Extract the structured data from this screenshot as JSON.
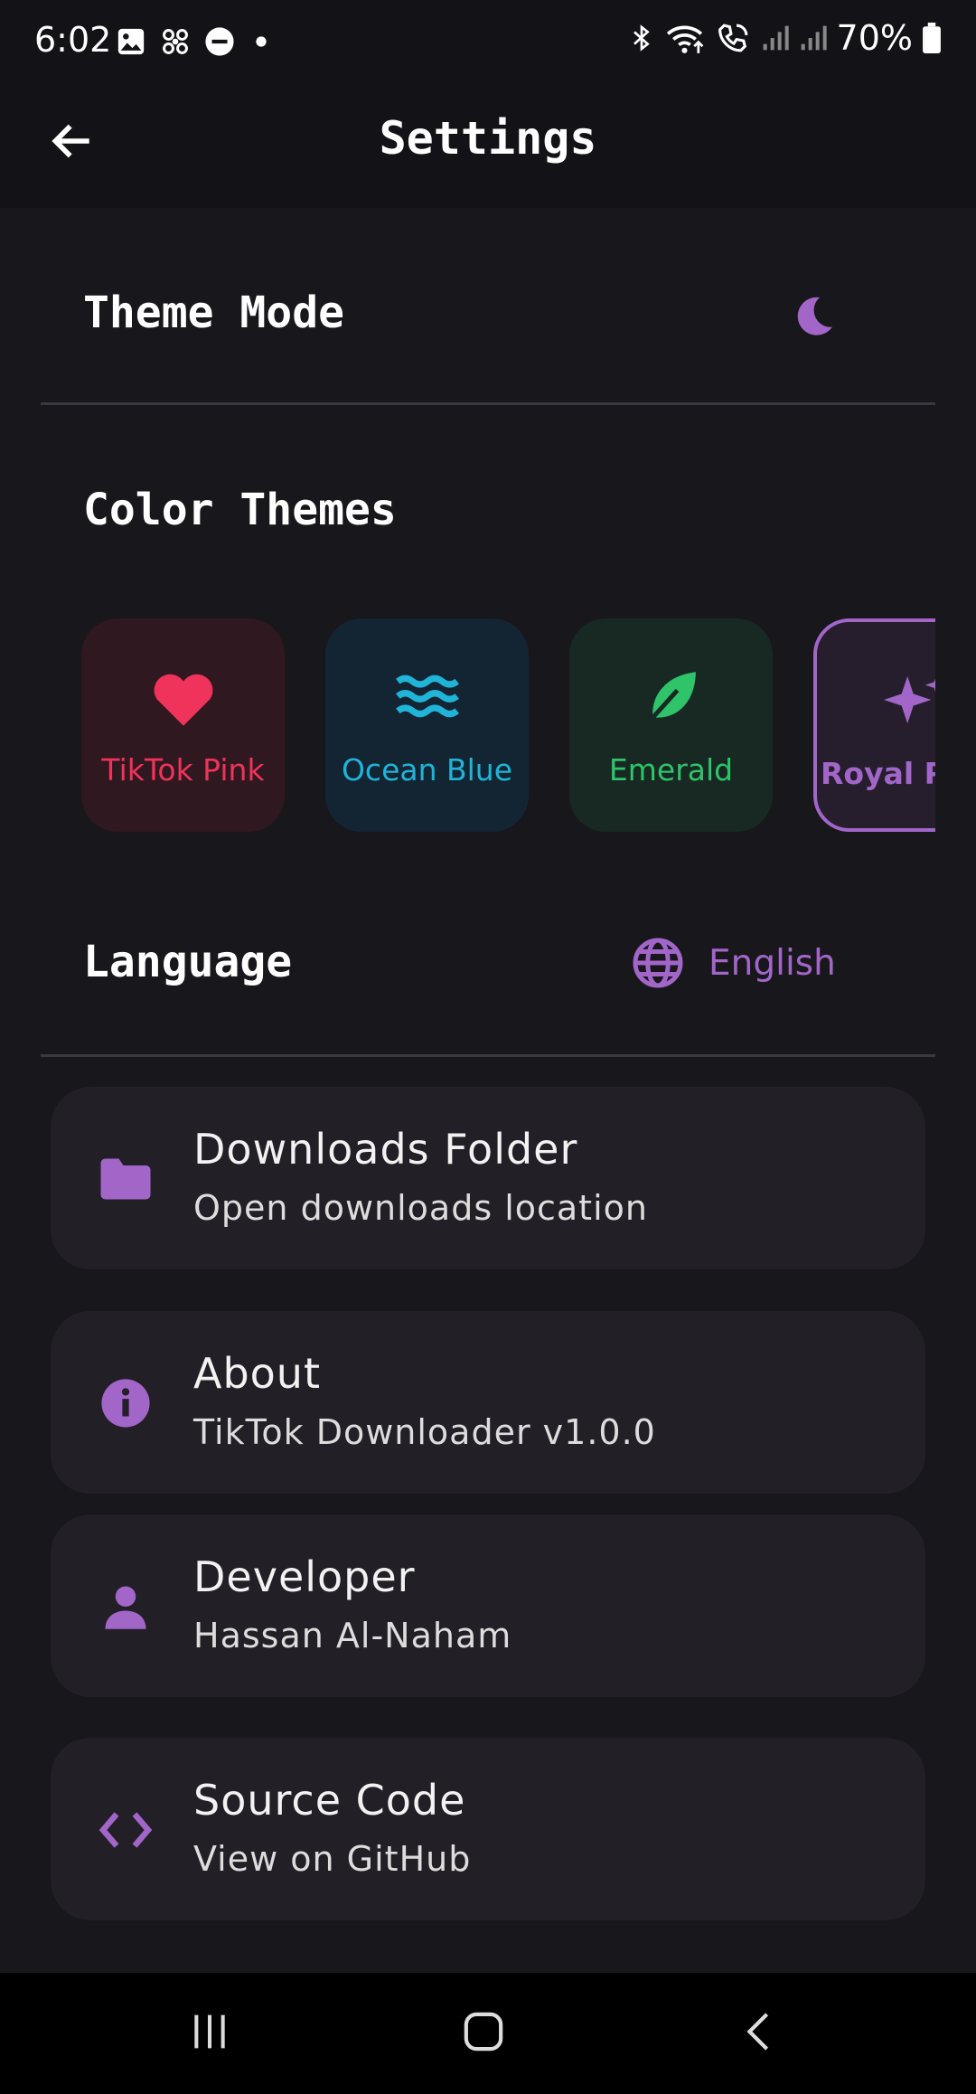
{
  "status_bar": {
    "time": "6:02",
    "battery": "70%",
    "icons": [
      "gallery-icon",
      "fan-icon",
      "dnd-icon",
      "dot-icon",
      "bluetooth-icon",
      "wifi-icon",
      "wifi-call-icon",
      "signal-icon",
      "signal-icon",
      "battery-icon"
    ]
  },
  "header": {
    "title": "Settings",
    "back_icon": "arrow-left-icon"
  },
  "theme_mode": {
    "label": "Theme Mode",
    "icon": "moon-icon"
  },
  "color_themes": {
    "label": "Color Themes",
    "items": [
      {
        "label": "TikTok Pink",
        "icon": "heart-icon",
        "color": "#f0335a",
        "bg": "#2f1820",
        "selected": false
      },
      {
        "label": "Ocean Blue",
        "icon": "waves-icon",
        "color": "#1fb4d8",
        "bg": "#132433",
        "selected": false
      },
      {
        "label": "Emerald",
        "icon": "leaf-icon",
        "color": "#2fc36a",
        "bg": "#172922",
        "selected": false
      },
      {
        "label": "Royal Pu",
        "icon": "sparkle-icon",
        "color": "#a266c9",
        "bg": "#261e2d",
        "selected": true
      }
    ]
  },
  "language": {
    "label": "Language",
    "value": "English",
    "icon": "globe-icon"
  },
  "list": [
    {
      "title": "Downloads Folder",
      "subtitle": "Open downloads location",
      "icon": "folder-icon"
    },
    {
      "title": "About",
      "subtitle": "TikTok Downloader v1.0.0",
      "icon": "info-icon"
    },
    {
      "title": "Developer",
      "subtitle": "Hassan Al-Naham",
      "icon": "person-icon"
    },
    {
      "title": "Source Code",
      "subtitle": "View on GitHub",
      "icon": "code-icon"
    }
  ],
  "nav_bar": {
    "icons": [
      "recents-icon",
      "home-icon",
      "back-icon"
    ]
  },
  "colors": {
    "accent": "#a266c9",
    "background": "#18171c",
    "card": "#221f26"
  }
}
